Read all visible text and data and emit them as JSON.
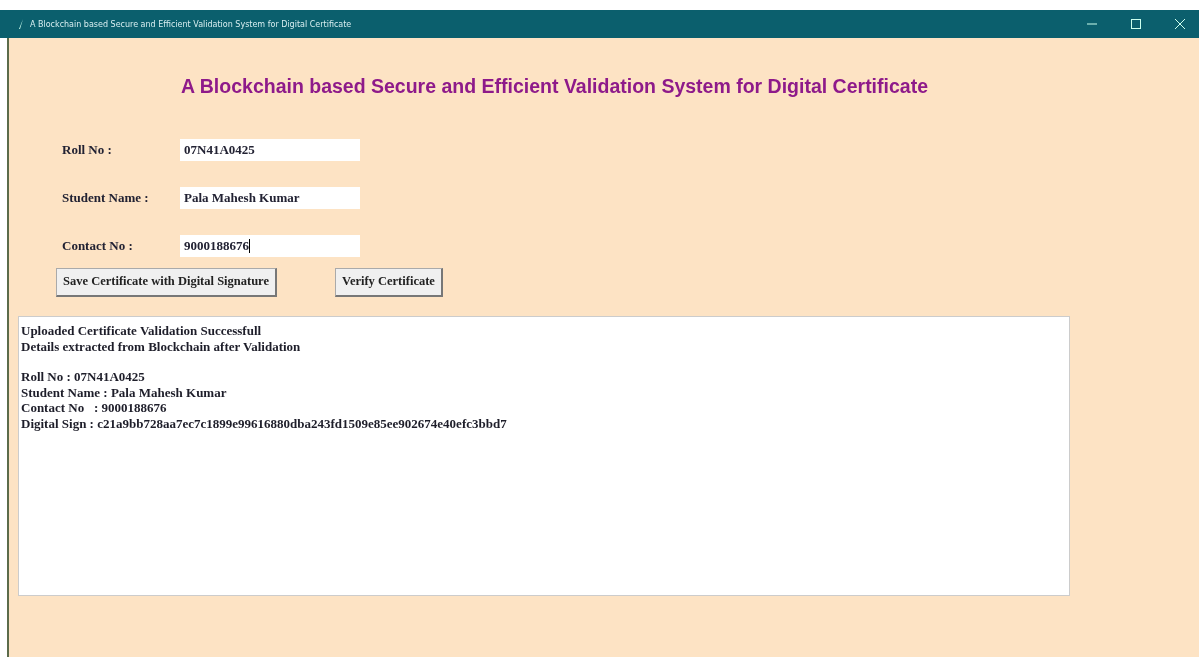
{
  "window": {
    "title": "A Blockchain based Secure and Efficient Validation System for Digital Certificate"
  },
  "heading": "A Blockchain based Secure and Efficient Validation System for Digital Certificate",
  "fields": [
    {
      "label": "Roll No :",
      "value": "07N41A0425",
      "focused": false
    },
    {
      "label": "Student Name :",
      "value": "Pala Mahesh Kumar",
      "focused": false
    },
    {
      "label": "Contact No :",
      "value": "9000188676",
      "focused": true
    }
  ],
  "buttons": [
    "Save Certificate with Digital Signature",
    "Verify Certificate"
  ],
  "output": {
    "paragraphs": [
      [
        "Uploaded Certificate Validation Successfull",
        "Details extracted from Blockchain after Validation"
      ],
      [
        "Roll No : 07N41A0425",
        "Student Name : Pala Mahesh Kumar",
        "Contact No   : 9000188676",
        "Digital Sign : c21a9bb728aa7ec7c1899e99616880dba243fd1509e85ee902674e40efc3bbd7"
      ]
    ]
  }
}
